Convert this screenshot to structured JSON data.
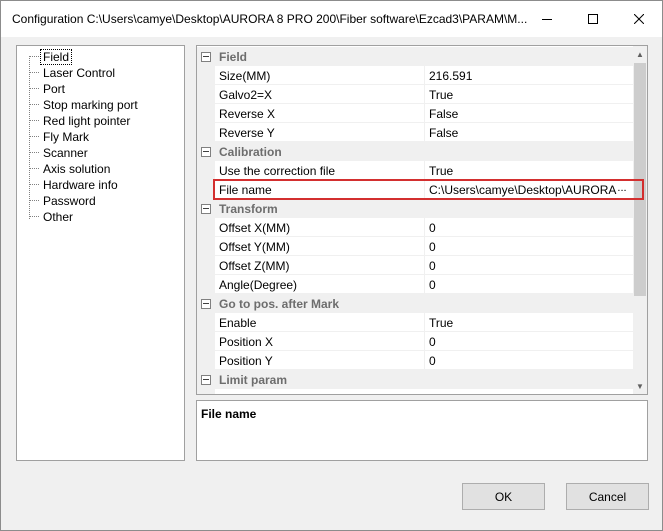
{
  "window": {
    "title": "Configuration C:\\Users\\camye\\Desktop\\AURORA 8 PRO 200\\Fiber software\\Ezcad3\\PARAM\\M...",
    "minimize_icon": "minimize-icon",
    "maximize_icon": "maximize-icon",
    "close_icon": "close-icon"
  },
  "tree": {
    "items": [
      {
        "label": "Field",
        "selected": true
      },
      {
        "label": "Laser Control"
      },
      {
        "label": "Port"
      },
      {
        "label": "Stop marking port"
      },
      {
        "label": "Red light pointer"
      },
      {
        "label": "Fly Mark"
      },
      {
        "label": "Scanner"
      },
      {
        "label": "Axis solution"
      },
      {
        "label": "Hardware info"
      },
      {
        "label": "Password"
      },
      {
        "label": "Other"
      }
    ]
  },
  "grid": {
    "categories": {
      "field": "Field",
      "calibration": "Calibration",
      "transform": "Transform",
      "goto": "Go to pos. after Mark",
      "limit": "Limit param"
    },
    "rows": {
      "size": {
        "name": "Size(MM)",
        "value": "216.591"
      },
      "galvo2": {
        "name": "Galvo2=X",
        "value": "True"
      },
      "reverse_x": {
        "name": "Reverse X",
        "value": "False"
      },
      "reverse_y": {
        "name": "Reverse Y",
        "value": "False"
      },
      "use_corr": {
        "name": "Use the correction file",
        "value": "True"
      },
      "file_name": {
        "name": "File name",
        "value": "C:\\Users\\camye\\Desktop\\AURORA",
        "button": "..."
      },
      "offset_x": {
        "name": "Offset X(MM)",
        "value": "0"
      },
      "offset_y": {
        "name": "Offset Y(MM)",
        "value": "0"
      },
      "offset_z": {
        "name": "Offset Z(MM)",
        "value": "0"
      },
      "angle": {
        "name": "Angle(Degree)",
        "value": "0"
      },
      "enable": {
        "name": "Enable",
        "value": "True"
      },
      "pos_x": {
        "name": "Position X",
        "value": "0"
      },
      "pos_y": {
        "name": "Position Y",
        "value": "0"
      }
    },
    "scroll_up_icon": "scroll-up-icon",
    "scroll_down_icon": "scroll-down-icon"
  },
  "description": {
    "title": "File name"
  },
  "buttons": {
    "ok": "OK",
    "cancel": "Cancel"
  }
}
